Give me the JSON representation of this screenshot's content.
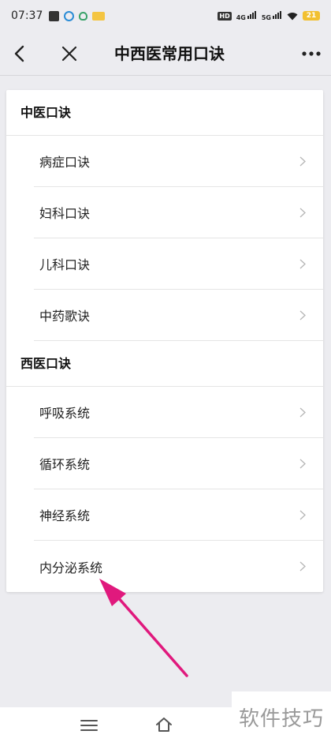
{
  "status_bar": {
    "time": "07:37",
    "hd_label": "HD",
    "net1": "4G",
    "net2": "5G",
    "battery": "21"
  },
  "nav": {
    "title": "中西医常用口诀"
  },
  "sections": [
    {
      "title": "中医口诀",
      "items": [
        "病症口诀",
        "妇科口诀",
        "儿科口诀",
        "中药歌诀"
      ]
    },
    {
      "title": "西医口诀",
      "items": [
        "呼吸系统",
        "循环系统",
        "神经系统",
        "内分泌系统"
      ]
    }
  ],
  "watermark": "软件技巧",
  "colors": {
    "background": "#ececf0",
    "card": "#ffffff",
    "annotation_arrow": "#e0197d",
    "battery": "#f2c030"
  },
  "icons": {
    "back": "chevron-left-icon",
    "close": "close-icon",
    "more": "more-dots-icon",
    "chevron": "chevron-right-icon",
    "menu": "menu-icon",
    "home": "home-icon"
  }
}
